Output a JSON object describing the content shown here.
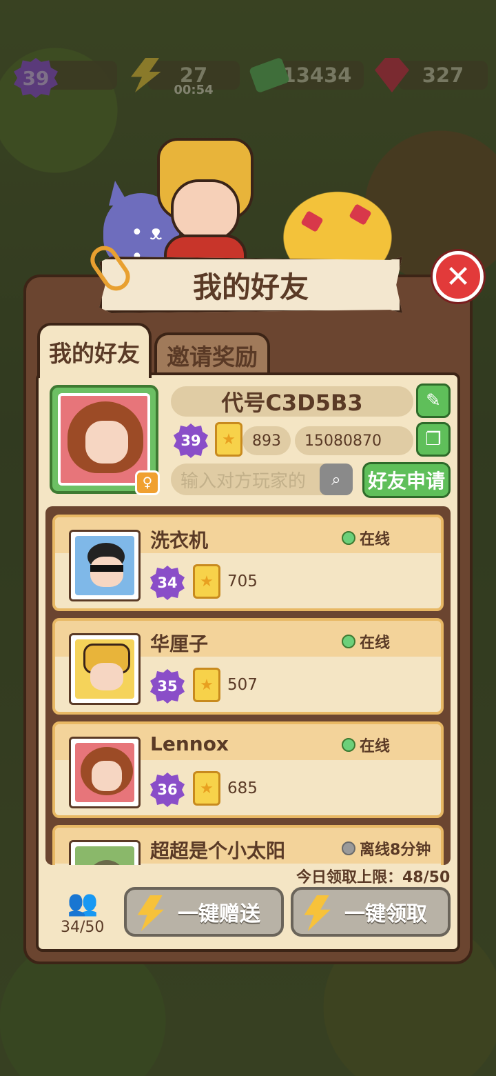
{
  "topbar": {
    "level": "39",
    "energy": "27",
    "energy_timer": "00:54",
    "cash": "13434",
    "gems": "327"
  },
  "dialog": {
    "title": "我的好友",
    "tabs": [
      "我的好友",
      "邀请奖励"
    ]
  },
  "profile": {
    "name": "代号C3D5B3",
    "level": "39",
    "score": "893",
    "id": "15080870",
    "search_placeholder": "输入对方玩家的",
    "request_button": "好友申请"
  },
  "friends": [
    {
      "name": "洗衣机",
      "status": "在线",
      "online": true,
      "level": "34",
      "score": "705"
    },
    {
      "name": "华厘子",
      "status": "在线",
      "online": true,
      "level": "35",
      "score": "507"
    },
    {
      "name": "Lennox",
      "status": "在线",
      "online": true,
      "level": "36",
      "score": "685"
    },
    {
      "name": "超超是个小太阳",
      "status": "离线8分钟",
      "online": false
    }
  ],
  "footer": {
    "daily_limit": "今日领取上限：48/50",
    "friend_count": "34/50",
    "send_all": "一键赠送",
    "claim_all": "一键领取"
  },
  "colors": {
    "panel": "#6b4530",
    "paper": "#f4e5c4",
    "green": "#5fbf5a",
    "close_red": "#e23a3a",
    "level_purple": "#8a4ec8"
  }
}
